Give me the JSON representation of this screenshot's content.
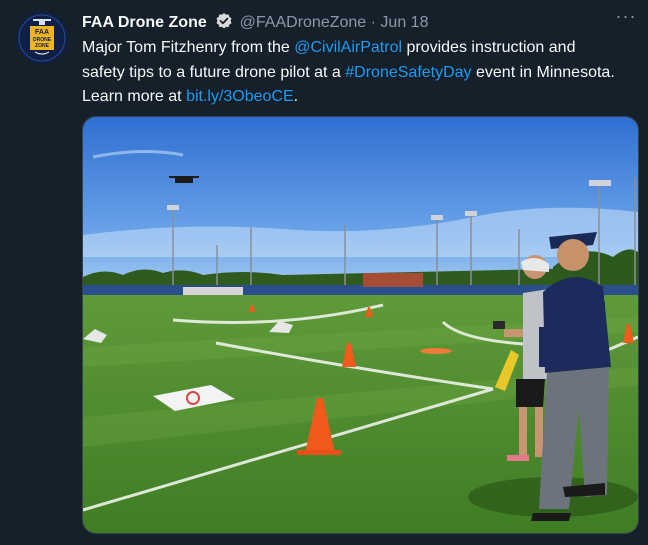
{
  "tweet": {
    "author_name": "FAA Drone Zone",
    "handle": "@FAADroneZone",
    "separator": "·",
    "date": "Jun 18",
    "more_label": "···",
    "text_parts": [
      {
        "type": "text",
        "value": "Major Tom Fitzhenry from the "
      },
      {
        "type": "link",
        "value": "@CivilAirPatrol"
      },
      {
        "type": "text",
        "value": " provides instruction and safety tips to a future drone pilot at a "
      },
      {
        "type": "link",
        "value": "#DroneSafetyDay"
      },
      {
        "type": "text",
        "value": " event in Minnesota. Learn more at "
      },
      {
        "type": "link",
        "value": "bit.ly/3ObeoCE"
      },
      {
        "type": "text",
        "value": "."
      }
    ],
    "avatar_logo_text": [
      "FAA",
      "DRONE",
      "ZONE"
    ]
  },
  "colors": {
    "background": "#15202b",
    "text": "#f7f9f9",
    "secondary": "#8b98a5",
    "link": "#1d9bf0",
    "verified_badge": "#d9d9d9"
  }
}
